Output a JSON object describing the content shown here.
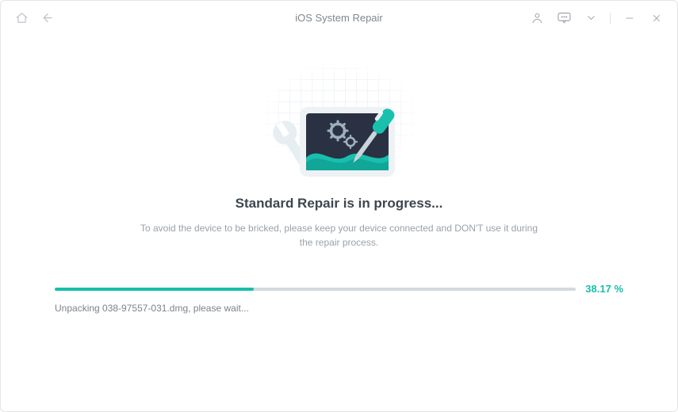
{
  "titlebar": {
    "title": "iOS System Repair"
  },
  "main": {
    "heading": "Standard Repair is in progress...",
    "subtext": "To avoid the device to be bricked, please keep your device connected and DON'T use it during the repair process."
  },
  "progress": {
    "percent_label": "38.17 %",
    "percent_value": 38.17,
    "status_text": "Unpacking 038-97557-031.dmg, please wait..."
  },
  "colors": {
    "accent": "#17bfa9"
  }
}
